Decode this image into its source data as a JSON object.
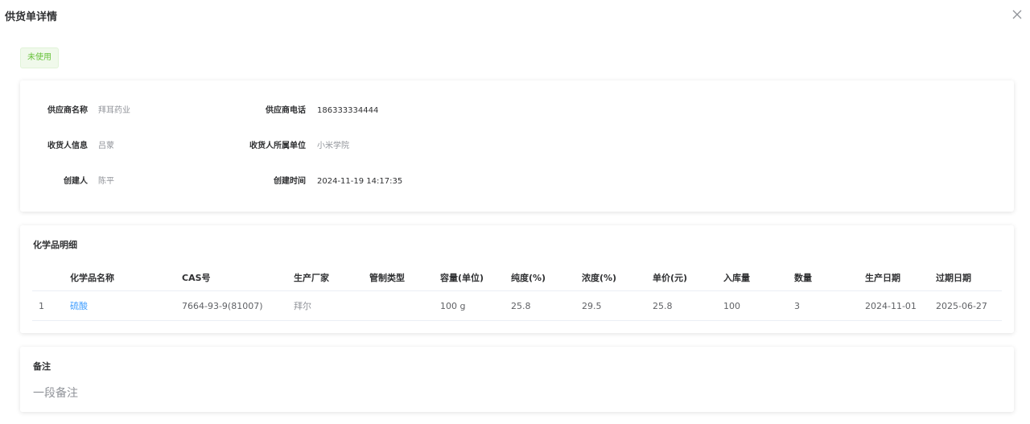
{
  "dialog": {
    "title": "供货单详情",
    "close_icon": "close-icon"
  },
  "status": {
    "label": "未使用",
    "color": "#67c23a"
  },
  "info": {
    "supplier_name_label": "供应商名称",
    "supplier_name": "拜耳药业",
    "supplier_phone_label": "供应商电话",
    "supplier_phone": "186333334444",
    "receiver_label": "收货人信息",
    "receiver": "吕蒙",
    "receiver_unit_label": "收货人所属单位",
    "receiver_unit": "小米学院",
    "creator_label": "创建人",
    "creator": "陈平",
    "created_time_label": "创建时间",
    "created_time": "2024-11-19 14:17:35"
  },
  "chemicals": {
    "title": "化学品明细",
    "columns": [
      "化学品名称",
      "CAS号",
      "生产厂家",
      "管制类型",
      "容量(单位)",
      "纯度(%)",
      "浓度(%)",
      "单价(元)",
      "入库量",
      "数量",
      "生产日期",
      "过期日期"
    ],
    "rows": [
      {
        "index": "1",
        "name": "硫酸",
        "cas": "7664-93-9(81007)",
        "manufacturer": "拜尔",
        "control_type": "",
        "capacity": "100 g",
        "purity": "25.8",
        "concentration": "29.5",
        "price": "25.8",
        "stock_in": "100",
        "quantity": "3",
        "production_date": "2024-11-01",
        "expiry_date": "2025-06-27"
      }
    ]
  },
  "remarks": {
    "title": "备注",
    "text": "一段备注"
  },
  "colors": {
    "link": "#409eff",
    "tag_bg": "#f0f9eb"
  }
}
